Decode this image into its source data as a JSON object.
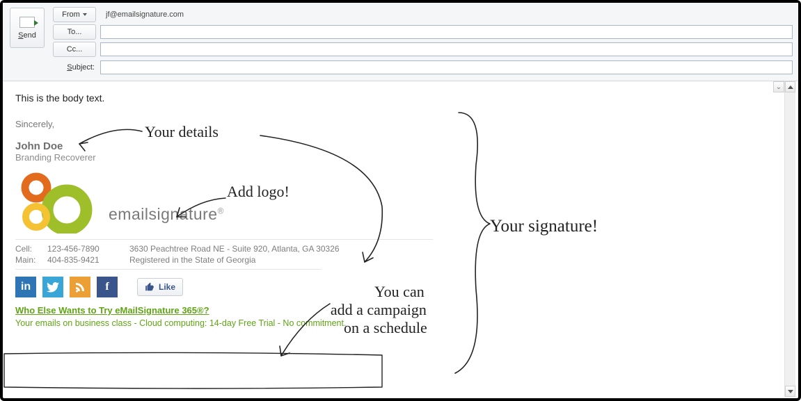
{
  "header": {
    "send_label": "Send",
    "from_label": "From",
    "from_value": "jf@emailsignature.com",
    "to_label": "To...",
    "cc_label": "Cc...",
    "subject_prefix": "S",
    "subject_suffix": "ubject:"
  },
  "body": {
    "text": "This is the body text.",
    "signoff": "Sincerely,",
    "name": "John Doe",
    "title": "Branding Recoverer",
    "brand": "emailsignature",
    "brand_reg": "®",
    "contact": {
      "cell_label": "Cell:",
      "cell_value": "123-456-7890",
      "main_label": "Main:",
      "main_value": "404-835-9421",
      "address": "3630 Peachtree Road NE - Suite 920, Atlanta, GA 30326",
      "registration": "Registered in the State of Georgia"
    },
    "like_label": "Like",
    "campaign_link": "Who Else Wants to Try eMailSignature 365®?",
    "campaign_text": "Your emails on business class - Cloud computing: 14-day Free Trial - No commitment."
  },
  "annotations": {
    "details": "Your details",
    "add_logo": "Add logo!",
    "signature": "Your signature!",
    "campaign1": "You can",
    "campaign2": "add a campaign",
    "campaign3": "on a schedule"
  },
  "social": {
    "in": "in",
    "tw": "",
    "rss": "",
    "fb": "f"
  }
}
